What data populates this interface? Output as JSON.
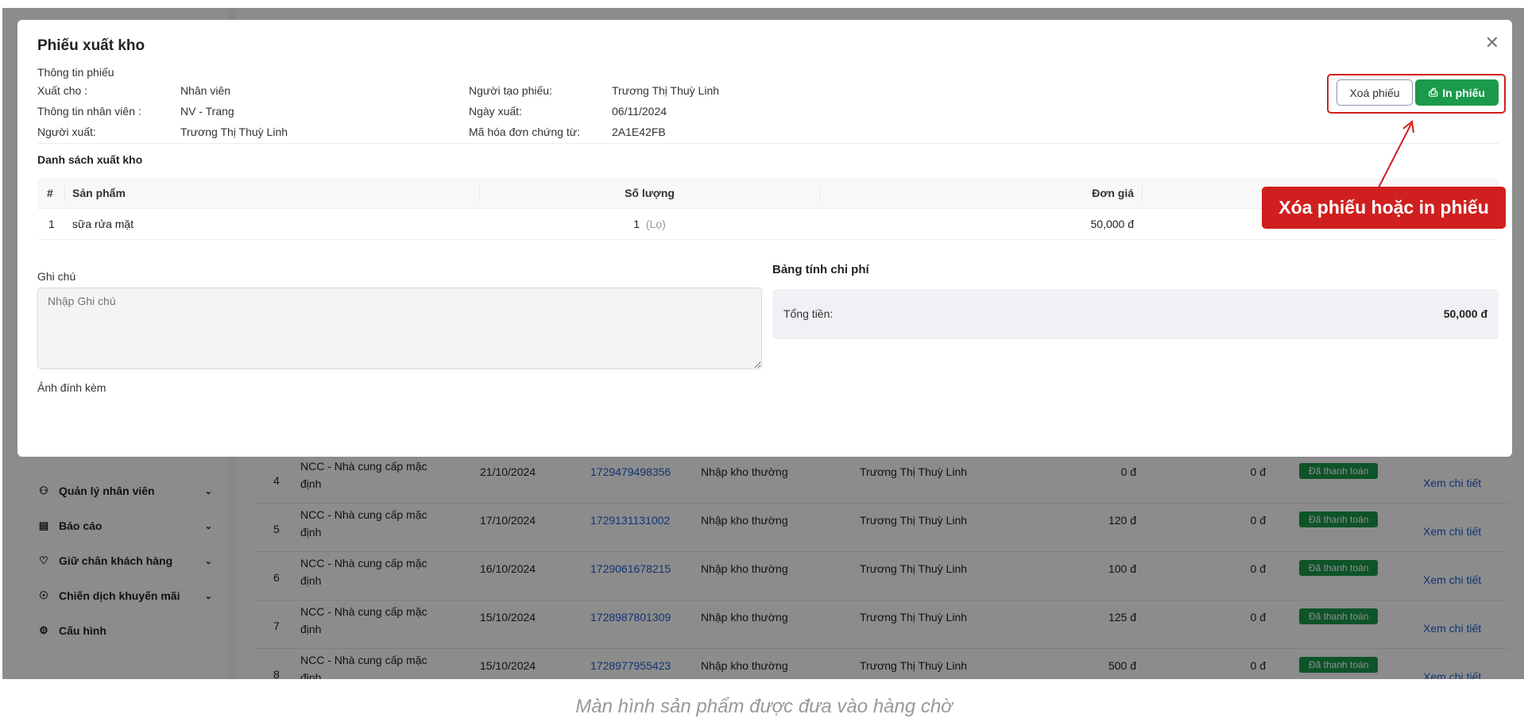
{
  "background": {
    "sidebar": [
      {
        "label": "Quản lý nhân viên",
        "icon": "user-group-icon"
      },
      {
        "label": "Báo cáo",
        "icon": "bar-chart-icon"
      },
      {
        "label": "Giữ chân khách hàng",
        "icon": "heart-icon"
      },
      {
        "label": "Chiến dịch khuyến mãi",
        "icon": "discount-icon"
      },
      {
        "label": "Cấu hình",
        "icon": "gear-icon"
      }
    ],
    "rows": [
      {
        "no": "4",
        "supplier": "NCC - Nhà cung cấp mặc định",
        "date": "21/10/2024",
        "code": "1729479498356",
        "type": "Nhập kho thường",
        "person": "Trương Thị Thuỳ Linh",
        "amount": "0 đ",
        "debt": "0 đ",
        "status": "Đã thanh toán",
        "action": "Xem chi tiết"
      },
      {
        "no": "5",
        "supplier": "NCC - Nhà cung cấp mặc định",
        "date": "17/10/2024",
        "code": "1729131131002",
        "type": "Nhập kho thường",
        "person": "Trương Thị Thuỳ Linh",
        "amount": "120 đ",
        "debt": "0 đ",
        "status": "Đã thanh toán",
        "action": "Xem chi tiết"
      },
      {
        "no": "6",
        "supplier": "NCC - Nhà cung cấp mặc định",
        "date": "16/10/2024",
        "code": "1729061678215",
        "type": "Nhập kho thường",
        "person": "Trương Thị Thuỳ Linh",
        "amount": "100 đ",
        "debt": "0 đ",
        "status": "Đã thanh toán",
        "action": "Xem chi tiết"
      },
      {
        "no": "7",
        "supplier": "NCC - Nhà cung cấp mặc định",
        "date": "15/10/2024",
        "code": "1728987801309",
        "type": "Nhập kho thường",
        "person": "Trương Thị Thuỳ Linh",
        "amount": "125 đ",
        "debt": "0 đ",
        "status": "Đã thanh toán",
        "action": "Xem chi tiết"
      },
      {
        "no": "8",
        "supplier": "NCC - Nhà cung cấp mặc định",
        "date": "15/10/2024",
        "code": "1728977955423",
        "type": "Nhập kho thường",
        "person": "Trương Thị Thuỳ Linh",
        "amount": "500 đ",
        "debt": "0 đ",
        "status": "Đã thanh toán",
        "action": "Xem chi tiết"
      }
    ]
  },
  "modal": {
    "title": "Phiếu xuất kho",
    "info_heading": "Thông tin phiếu",
    "info": {
      "left": [
        {
          "label": "Xuất cho :",
          "value": "Nhân viên"
        },
        {
          "label": "Thông tin nhân viên :",
          "value": "NV - Trang"
        },
        {
          "label": "Người xuất:",
          "value": "Trương Thị Thuỳ Linh"
        }
      ],
      "right": [
        {
          "label": "Người tạo phiếu:",
          "value": "Trương Thị Thuỳ Linh"
        },
        {
          "label": "Ngày xuất:",
          "value": "06/11/2024"
        },
        {
          "label": "Mã hóa đơn chứng từ:",
          "value": "2A1E42FB"
        }
      ]
    },
    "delete_label": "Xoá phiếu",
    "print_label": "In phiếu",
    "list_heading": "Danh sách xuất kho",
    "table": {
      "headers": [
        "#",
        "Sản phẩm",
        "Số lượng",
        "Đơn giá"
      ],
      "rows": [
        {
          "no": "1",
          "product": "sữa rửa mặt",
          "qty": "1",
          "unit": "(Lọ)",
          "price": "50,000 đ"
        }
      ]
    },
    "note_label": "Ghi chú",
    "note_placeholder": "Nhập Ghi chú",
    "note_value": "",
    "attachment_label": "Ảnh đính kèm",
    "cost_heading": "Bảng tính chi phí",
    "total_label": "Tổng tiền:",
    "total_value": "50,000 đ"
  },
  "annotation": {
    "callout": "Xóa phiếu hoặc in phiếu",
    "color": "#d01f1f"
  },
  "caption": "Màn hình sản phẩm được đưa vào hàng chờ",
  "colors": {
    "primary_green": "#1a9a4a",
    "link_blue": "#1d5fd1"
  }
}
